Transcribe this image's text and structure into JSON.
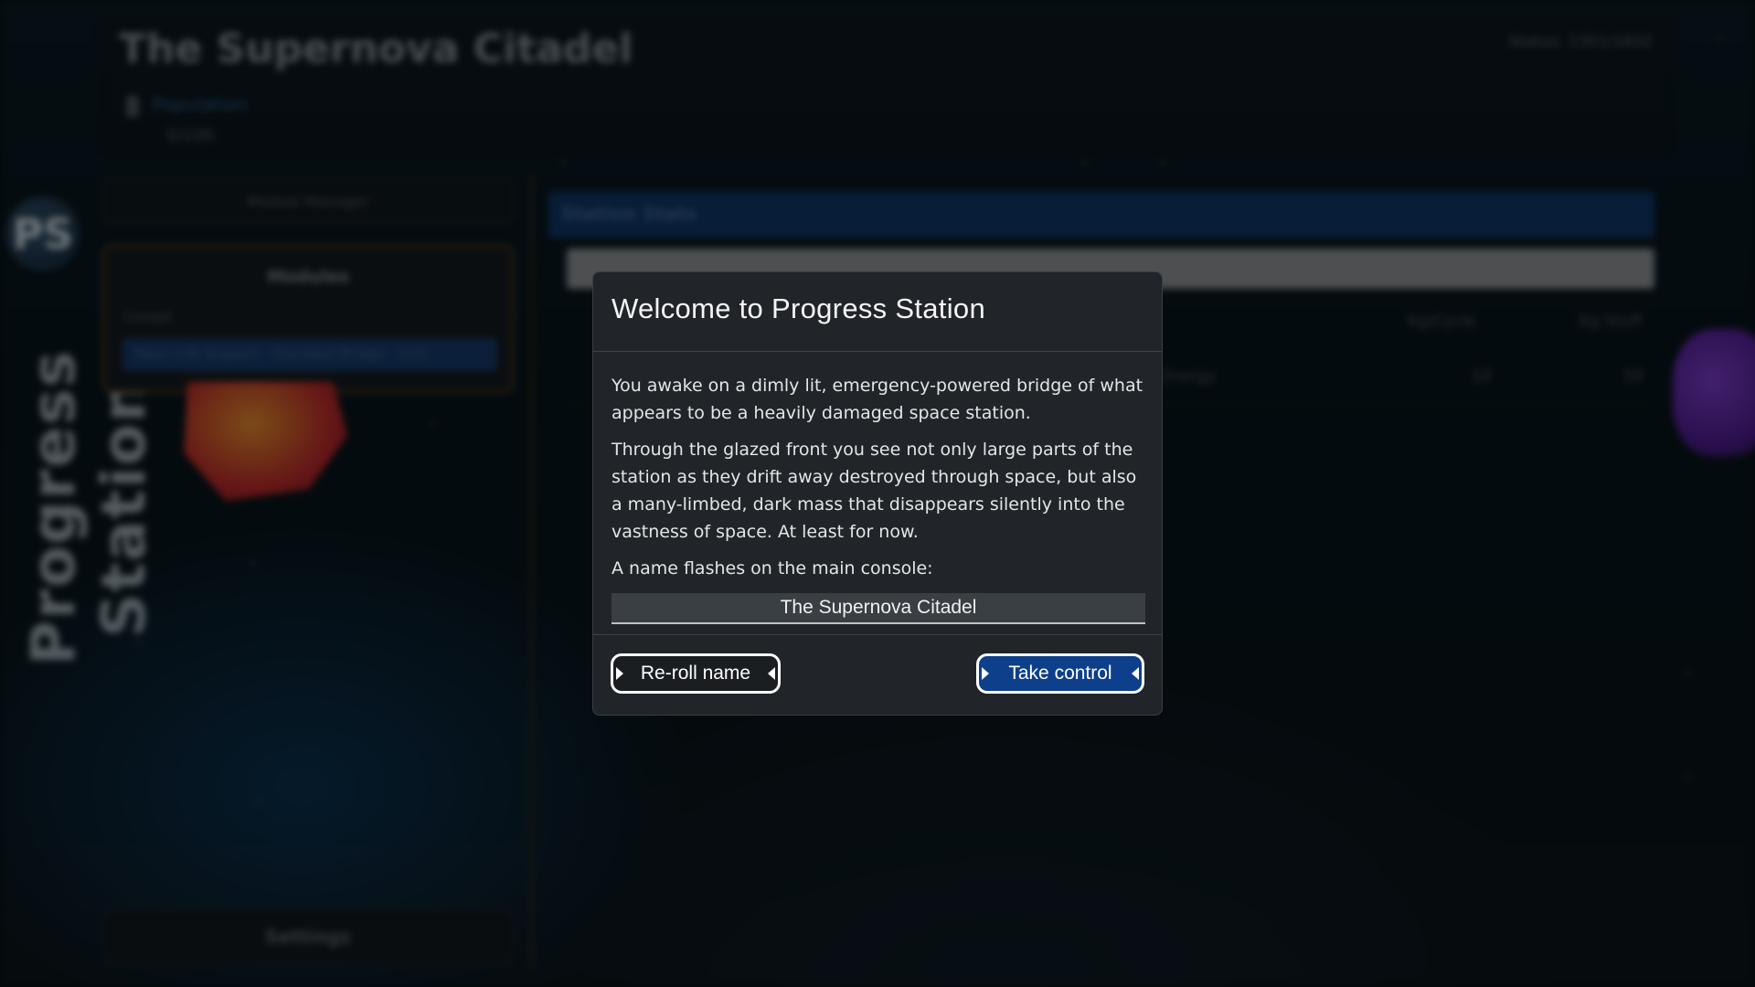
{
  "background_app": {
    "title": "The Supernova Citadel",
    "status": "Status: 1351/1832",
    "population_label": "Population",
    "population_value": "0/100",
    "left_top_button": "Module Manager",
    "modules_title": "Modules",
    "modules_sub": "Cockpit",
    "modules_bar": "Basic Life Support - Standard Bridge - 1x/1",
    "settings_label": "Settings",
    "sidebar_logo": "PS",
    "sidebar_title": "Progress Station",
    "stats_header": "Station Stats",
    "col_header_1": "Kg/Cycle",
    "col_header_2": "Kg Stuff",
    "row_text": "Energy",
    "row_value_1": "10",
    "row_value_2": "50"
  },
  "modal": {
    "title": "Welcome to Progress Station",
    "paragraph_1": "You awake on a dimly lit, emergency-powered bridge of what appears to be a heavily damaged space station.",
    "paragraph_2": "Through the glazed front you see not only large parts of the station as they drift away destroyed through space, but also a many-limbed, dark mass that disappears silently into the vastness of space. At least for now.",
    "paragraph_3": "A name flashes on the main console:",
    "station_name": "The Supernova Citadel",
    "reroll_label": "Re-roll name",
    "take_control_label": "Take control"
  },
  "colors": {
    "modal_bg": "#212529",
    "primary_button": "#0d3f8a",
    "secondary_button": "#1b1e21",
    "name_box": "#3a3f44"
  }
}
